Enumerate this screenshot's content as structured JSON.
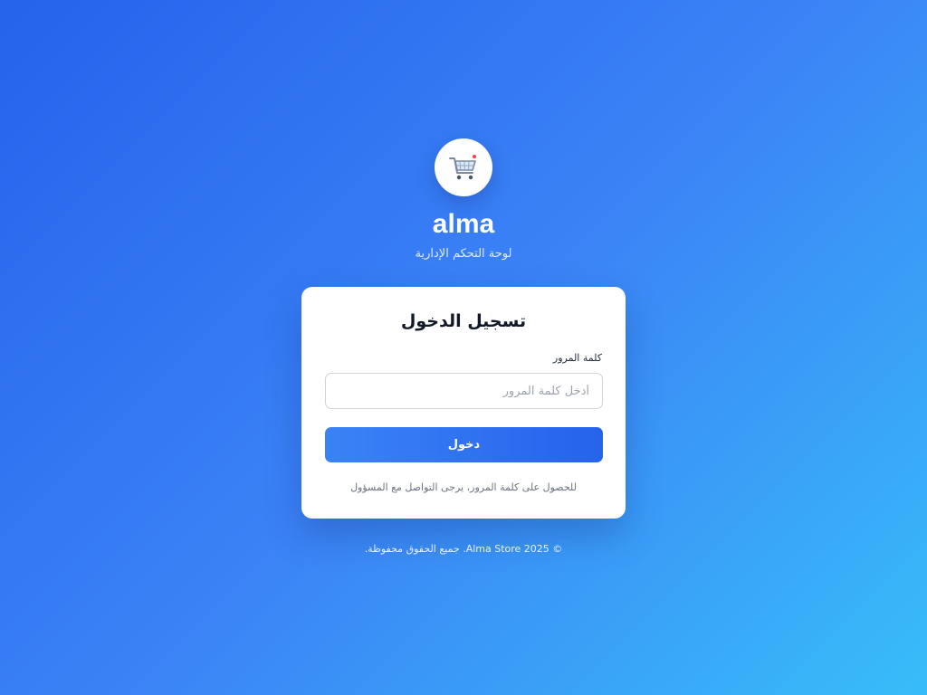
{
  "brand": {
    "logo_icon": "shopping-cart-icon",
    "name": "alma",
    "subtitle": "لوحة التحكم الإدارية"
  },
  "login_card": {
    "title": "تسجيل الدخول",
    "password_label": "كلمة المرور",
    "password_placeholder": "أدخل كلمة المرور",
    "password_value": "",
    "submit_label": "دخول",
    "help_text": "للحصول على كلمة المرور، يرجى التواصل مع المسؤول"
  },
  "footer": {
    "copyright": "© 2025 Alma Store. جميع الحقوق محفوظة."
  },
  "colors": {
    "background_start": "#2563eb",
    "background_end": "#38bdf8",
    "accent": "#3b82f6",
    "card": "#ffffff"
  }
}
